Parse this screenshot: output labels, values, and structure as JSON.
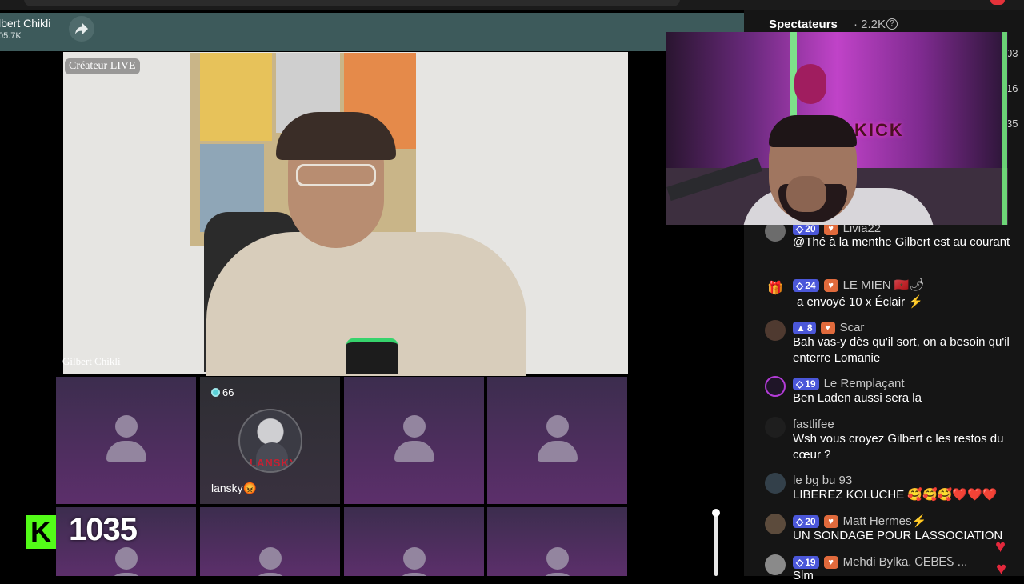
{
  "host": {
    "name": "lbert Chikli",
    "followers": "05.7K"
  },
  "main_video": {
    "creator_badge": "Créateur LIVE",
    "name": "Gilbert Chikli"
  },
  "guests": [
    {
      "badge_count": "66",
      "name": "lansky😡",
      "avatar_text": "LANSKY"
    }
  ],
  "kick": {
    "logo": "K",
    "count": "1035"
  },
  "viewers": {
    "label": "Spectateurs",
    "count": "· 2.2K",
    "help": "?"
  },
  "edge_numbers": [
    "03",
    "16",
    "35"
  ],
  "chat": [
    {
      "level": "20",
      "user": "Livia22",
      "text": "@Thé à la menthe Gilbert est au courant"
    },
    {
      "level": "24",
      "user": "LE MIEN 🇲🇦🌶",
      "gift": "a envoyé 10 x Éclair",
      "bolt": "⚡"
    },
    {
      "level": "8",
      "user": "Scar",
      "text": "Bah vas-y dès qu'il sort, on a besoin qu'il enterre Lomanie"
    },
    {
      "level": "19",
      "user": "Le Remplaçant",
      "text": "Ben Laden aussi sera la"
    },
    {
      "user": "fastlifee",
      "text": "Wsh vous croyez Gilbert c les restos du cœur ?"
    },
    {
      "user": "le bg bu 93",
      "text": "LIBEREZ KOLUCHE 🥰🥰🥰❤️❤️❤️"
    },
    {
      "level": "20",
      "user": "Matt Hermes⚡",
      "text": "UN SONDAGE POUR LASSOCIATION"
    },
    {
      "level": "19",
      "user": "Mehdi Bylka. ᏟᎬᏴᎬᏚ ...",
      "text": "Slm"
    }
  ],
  "colors": {
    "kick_green": "#53fc18",
    "header_teal": "#3d5a5b",
    "level_badge": "#4b57d9"
  }
}
